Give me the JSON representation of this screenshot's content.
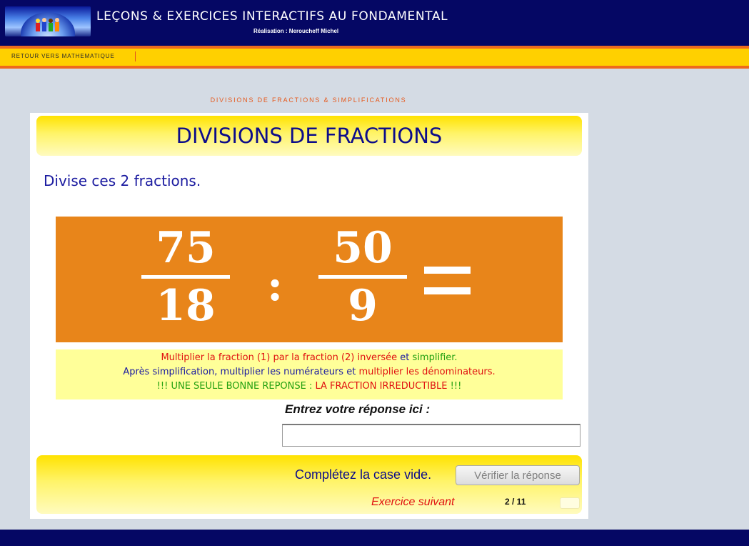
{
  "header": {
    "title": "LEÇONS & EXERCICES INTERACTIFS AU FONDAMENTAL",
    "subtitle": "Réalisation : Neroucheff Michel",
    "logo_icon": "children-logo-icon"
  },
  "nav": {
    "back_link": "RETOUR VERS MATHEMATIQUE"
  },
  "breadcrumb": "DIVISIONS DE FRACTIONS & SIMPLIFICATIONS",
  "exercise": {
    "title": "DIVISIONS DE FRACTIONS",
    "instruction": "Divise ces 2 fractions.",
    "fraction1": {
      "numerator": "75",
      "denominator": "18"
    },
    "operator": ":",
    "fraction2": {
      "numerator": "50",
      "denominator": "9"
    },
    "hints": {
      "line1_part1": "Multiplier la fraction (1) par la fraction (2) inversée",
      "line1_part2": " et ",
      "line1_part3": "simplifier.",
      "line2_part1": "Après simplification, multiplier les numérateurs",
      "line2_part2": " et ",
      "line2_part3": "multiplier les dénominateurs.",
      "line3_part1": "!!! UNE SEULE BONNE REPONSE : ",
      "line3_part2": "LA FRACTION IRREDUCTIBLE",
      "line3_part3": " !!!"
    },
    "answer_prompt": "Entrez votre réponse ici :",
    "answer_value": "",
    "status": "Complétez la case vide.",
    "verify_label": "Vérifier la réponse",
    "next_label": "Exercice suivant",
    "counter": "2 / 11"
  },
  "colors": {
    "header": "#050764",
    "nav": "#ffd000",
    "accent": "#ee6a1d",
    "fraction_panel": "#e8851a",
    "hint_panel": "#ffff99"
  }
}
